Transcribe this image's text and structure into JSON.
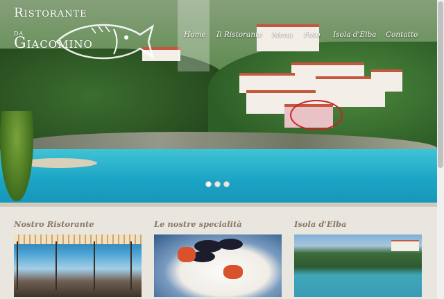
{
  "logo": {
    "line1": "Ristorante",
    "line2": "da",
    "line3": "Giacomino"
  },
  "nav": {
    "items": [
      {
        "label": "Home",
        "active": true
      },
      {
        "label": "Il Ristorante",
        "active": false
      },
      {
        "label": "Menu",
        "active": false
      },
      {
        "label": "Foto",
        "active": false
      },
      {
        "label": "Isola d'Elba",
        "active": false
      },
      {
        "label": "Contatto",
        "active": false
      }
    ]
  },
  "slider": {
    "slide_count": 3,
    "active_slide": 1
  },
  "sections": [
    {
      "title": "Nostro Ristorante",
      "image": "restaurant-terrace-photo"
    },
    {
      "title": "Le nostre specialità",
      "image": "seafood-plate-photo"
    },
    {
      "title": "Isola d'Elba",
      "image": "elba-coast-photo"
    }
  ],
  "colors": {
    "nav_text": "#ffffff",
    "section_title": "#8a7865",
    "page_background": "#e9e6df",
    "highlight_circle": "#c8222a"
  }
}
